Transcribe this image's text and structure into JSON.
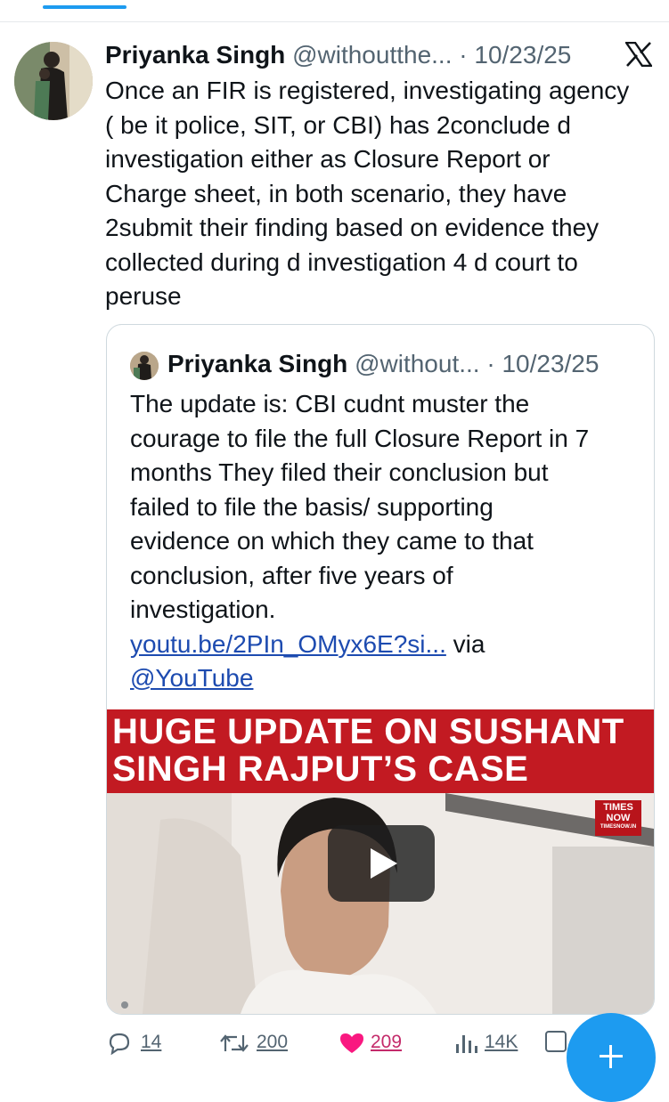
{
  "tweet": {
    "author_name": "Priyanka Singh",
    "handle": "@withoutthe...",
    "separator": "·",
    "date": "10/23/25",
    "text_lines": [
      "Once an FIR is registered, investigating agency",
      "( be it police, SIT, or CBI) has 2conclude d",
      "investigation either as Closure Report or",
      "Charge sheet, in both scenario, they have",
      "2submit their finding based on evidence they",
      "collected during d investigation 4 d court to",
      "peruse"
    ]
  },
  "quote": {
    "author_name": "Priyanka Singh",
    "handle": "@without...",
    "separator": "·",
    "date": "10/23/25",
    "text_lines": [
      "The update is: CBI cudnt muster the",
      "courage to file the full Closure Report in 7",
      "months They filed their conclusion but",
      "failed to file the basis/ supporting",
      "evidence on which they came to that",
      "conclusion, after five years of",
      "investigation."
    ],
    "link_text": "youtu.be/2PIn_OMyx6E?si...",
    "via_text": "via",
    "mention": "@YouTube",
    "video": {
      "headline_line1": "HUGE UPDATE ON SUSHANT",
      "headline_line2": "SINGH RAJPUT’S CASE",
      "channel_logo_line1": "TIMES",
      "channel_logo_line2": "NOW",
      "channel_logo_line3": "TIMESNOW.IN"
    }
  },
  "actions": {
    "replies": "14",
    "reposts": "200",
    "likes": "209",
    "views": "14K"
  },
  "colors": {
    "accent": "#1d9bf0",
    "like": "#c42a6a",
    "banner": "#c21a22",
    "muted": "#536471"
  }
}
